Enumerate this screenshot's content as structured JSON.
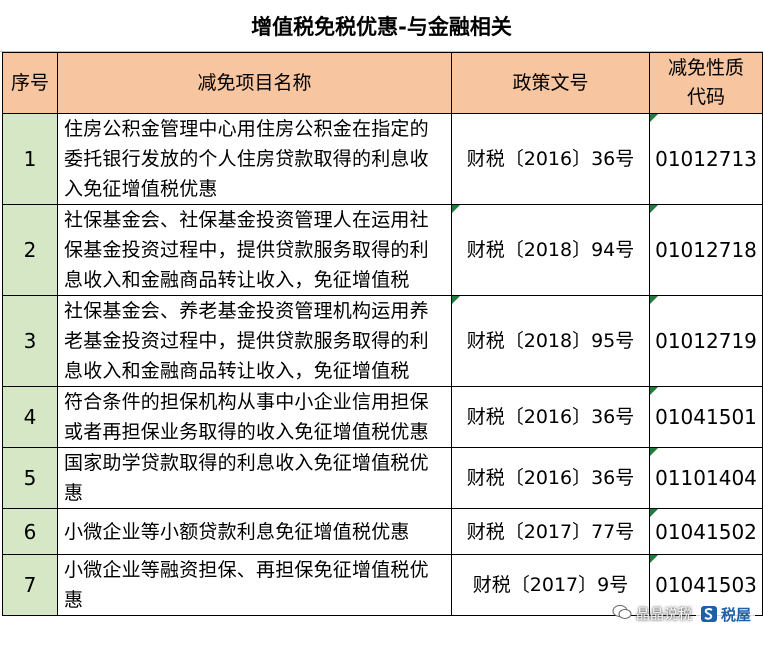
{
  "title": "增值税免税优惠-与金融相关",
  "headers": {
    "seq": "序号",
    "name": "减免项目名称",
    "policy": "政策文号",
    "code_line1": "减免性质",
    "code_line2": "代码"
  },
  "rows": [
    {
      "seq": "1",
      "name": "住房公积金管理中心用住房公积金在指定的委托银行发放的个人住房贷款取得的利息收入免征增值税优惠",
      "policy": "财税〔2016〕36号",
      "code": "01012713"
    },
    {
      "seq": "2",
      "name": "社保基金会、社保基金投资管理人在运用社保基金投资过程中，提供贷款服务取得的利息收入和金融商品转让收入，免征增值税",
      "policy": "财税〔2018〕94号",
      "code": "01012718"
    },
    {
      "seq": "3",
      "name": "社保基金会、养老基金投资管理机构运用养老基金投资过程中，提供贷款服务取得的利息收入和金融商品转让收入，免征增值税",
      "policy": "财税〔2018〕95号",
      "code": "01012719"
    },
    {
      "seq": "4",
      "name": "符合条件的担保机构从事中小企业信用担保或者再担保业务取得的收入免征增值税优惠",
      "policy": "财税〔2016〕36号",
      "code": "01041501"
    },
    {
      "seq": "5",
      "name": "国家助学贷款取得的利息收入免征增值税优惠",
      "policy": "财税〔2016〕36号",
      "code": "01101404"
    },
    {
      "seq": "6",
      "name": "小微企业等小额贷款利息免征增值税优惠",
      "policy": "财税〔2017〕77号",
      "code": "01041502"
    },
    {
      "seq": "7",
      "name": "小微企业等融资担保、再担保免征增值税优惠",
      "policy": "财税〔2017〕9号",
      "code": "01041503"
    }
  ],
  "watermark": {
    "account": "晶晶说税",
    "brand": "税屋"
  },
  "colors": {
    "header_bg": "#f7c59f",
    "seq_bg": "#d6e7c6",
    "corner_marker": "#1e7d3a"
  }
}
